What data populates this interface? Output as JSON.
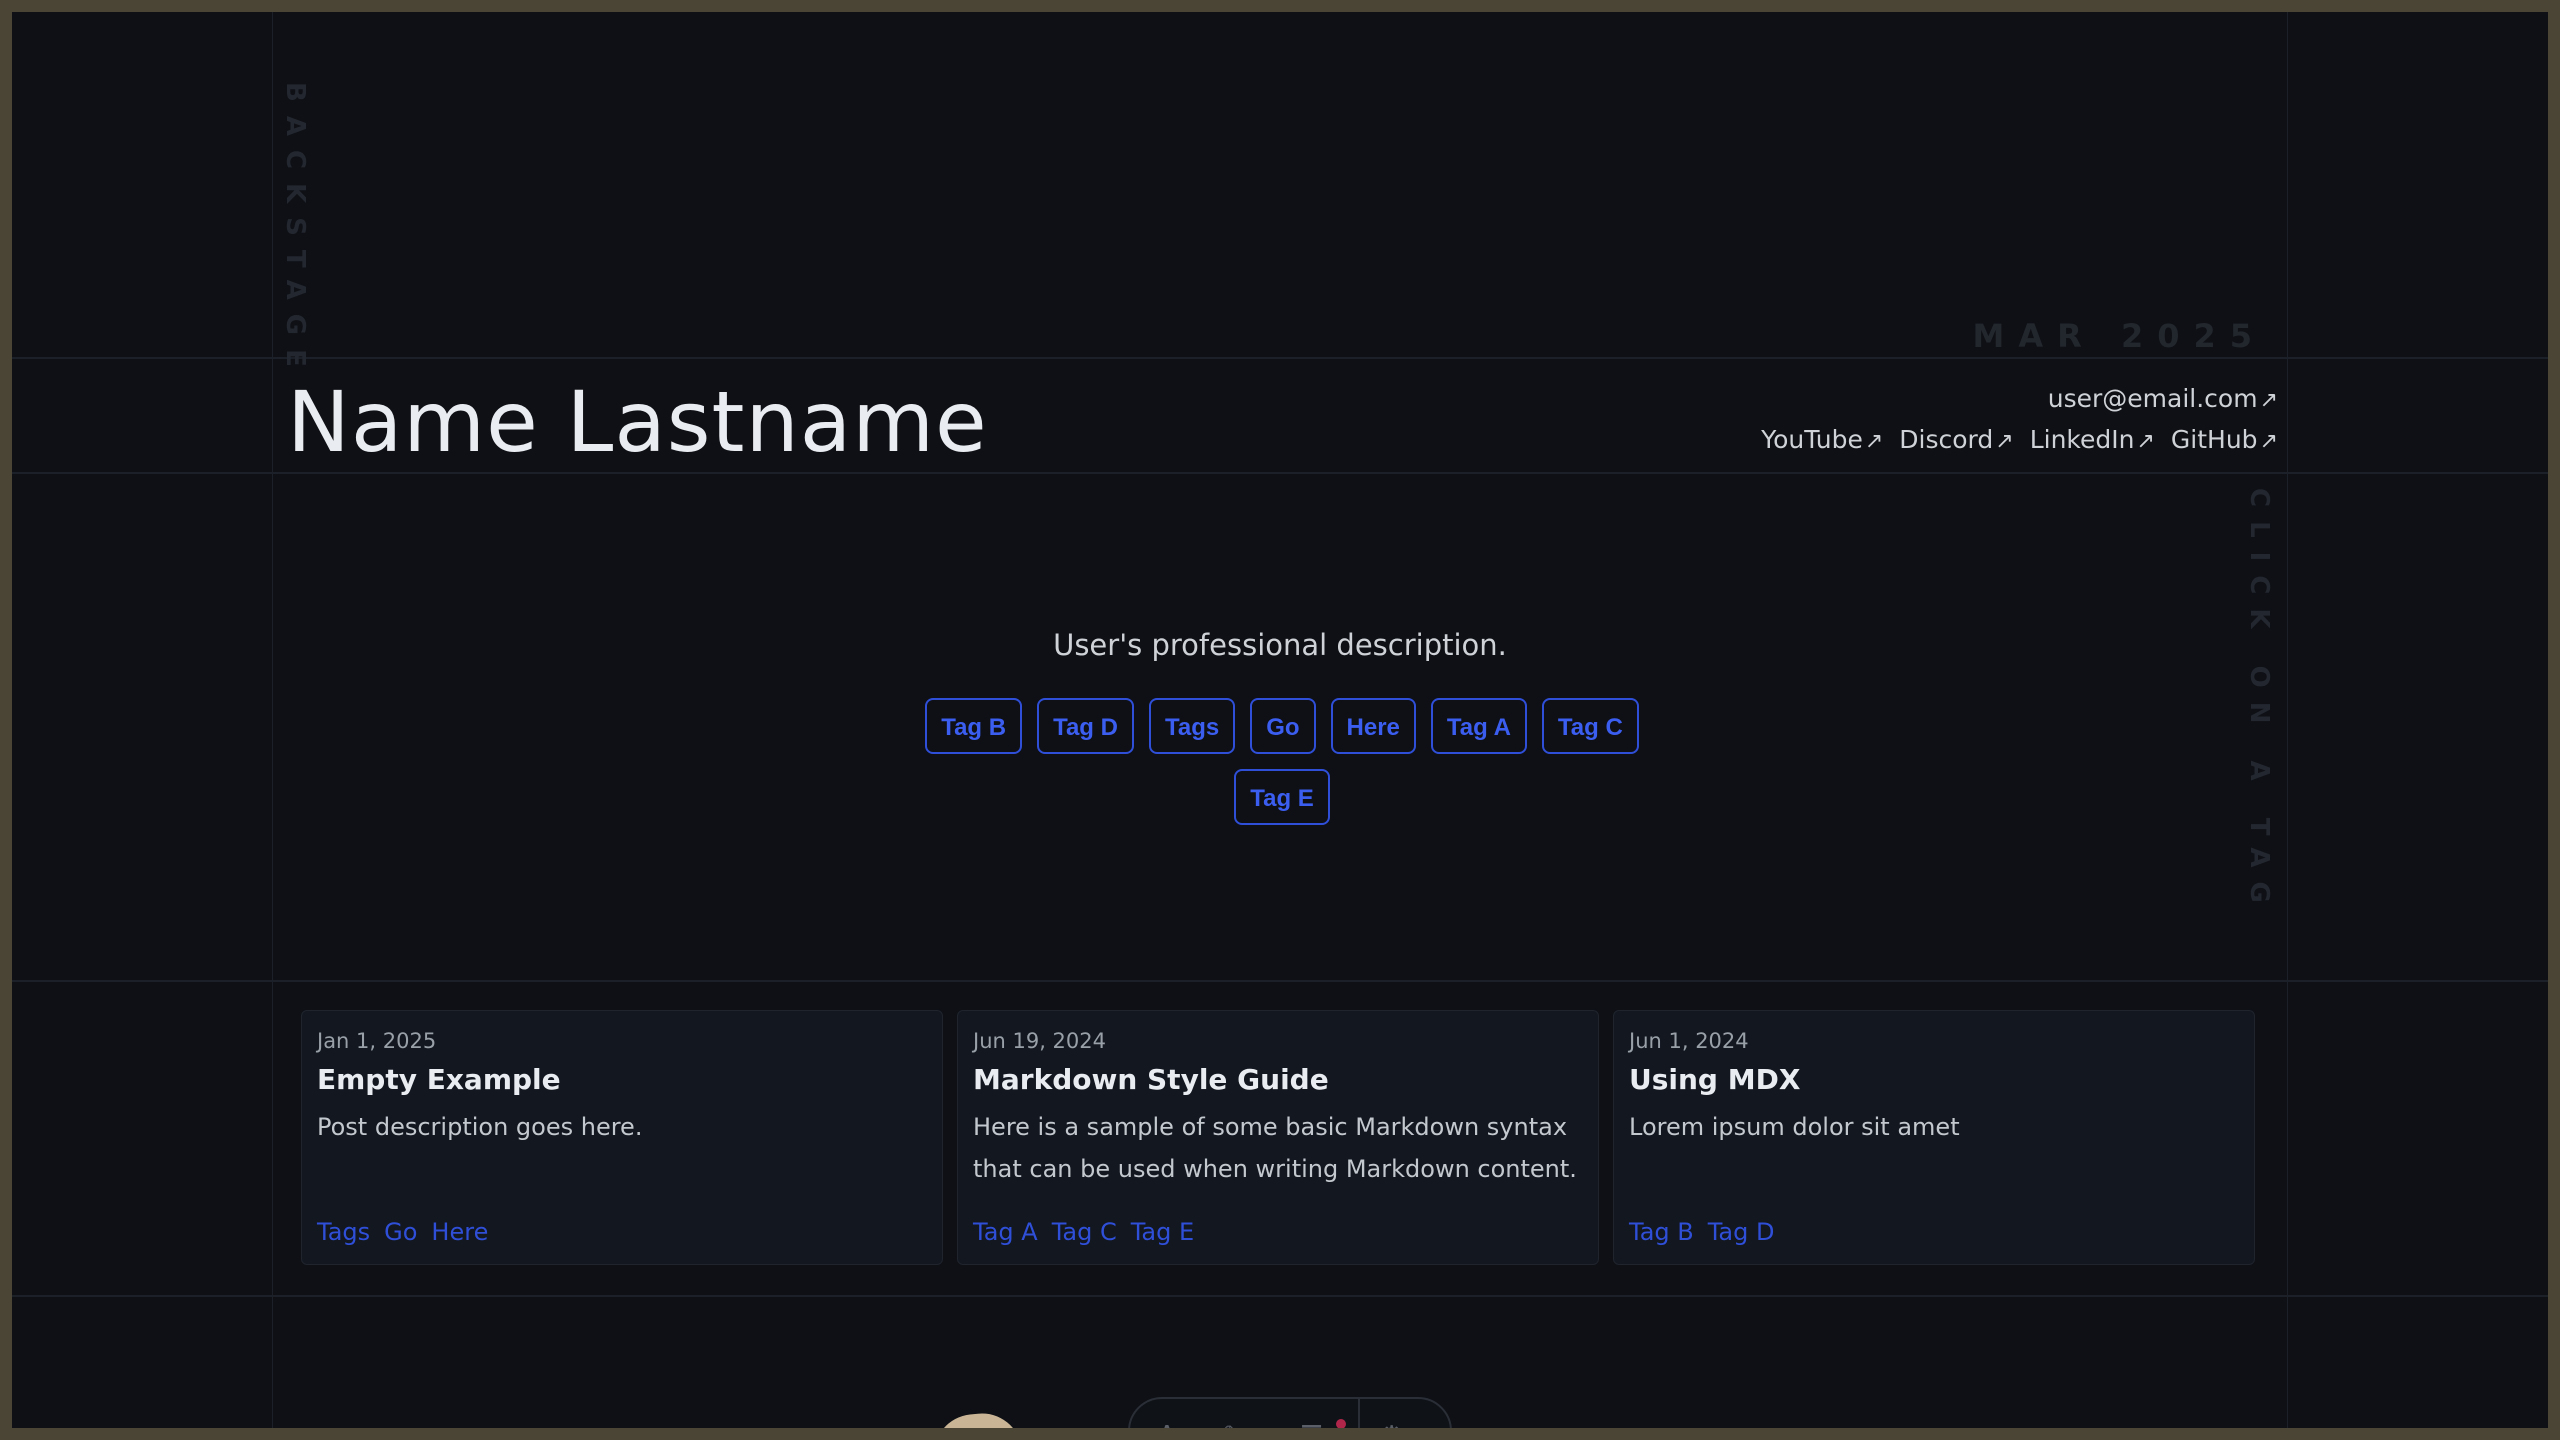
{
  "backstage": "BACKSTAGE",
  "date_marker": "MAR 2025",
  "click_hint": "CLICK ON A TAG",
  "profile": {
    "name": "Name Lastname",
    "email": "user@email.com",
    "links": [
      "YouTube",
      "Discord",
      "LinkedIn",
      "GitHub"
    ],
    "description": "User's professional description."
  },
  "tags": [
    "Tag B",
    "Tag D",
    "Tags",
    "Go",
    "Here",
    "Tag A",
    "Tag C",
    "Tag E"
  ],
  "posts": [
    {
      "date": "Jan 1, 2025",
      "title": "Empty Example",
      "description": "Post description goes here.",
      "tags": [
        "Tags",
        "Go",
        "Here"
      ]
    },
    {
      "date": "Jun 19, 2024",
      "title": "Markdown Style Guide",
      "description": "Here is a sample of some basic Markdown syntax that can be used when writing Markdown content.",
      "tags": [
        "Tag A",
        "Tag C",
        "Tag E"
      ]
    },
    {
      "date": "Jun 1, 2024",
      "title": "Using MDX",
      "description": "Lorem ipsum dolor sit amet",
      "tags": [
        "Tag B",
        "Tag D"
      ]
    }
  ],
  "colors": {
    "accent": "#3b5ef0",
    "background": "#0e1015"
  }
}
